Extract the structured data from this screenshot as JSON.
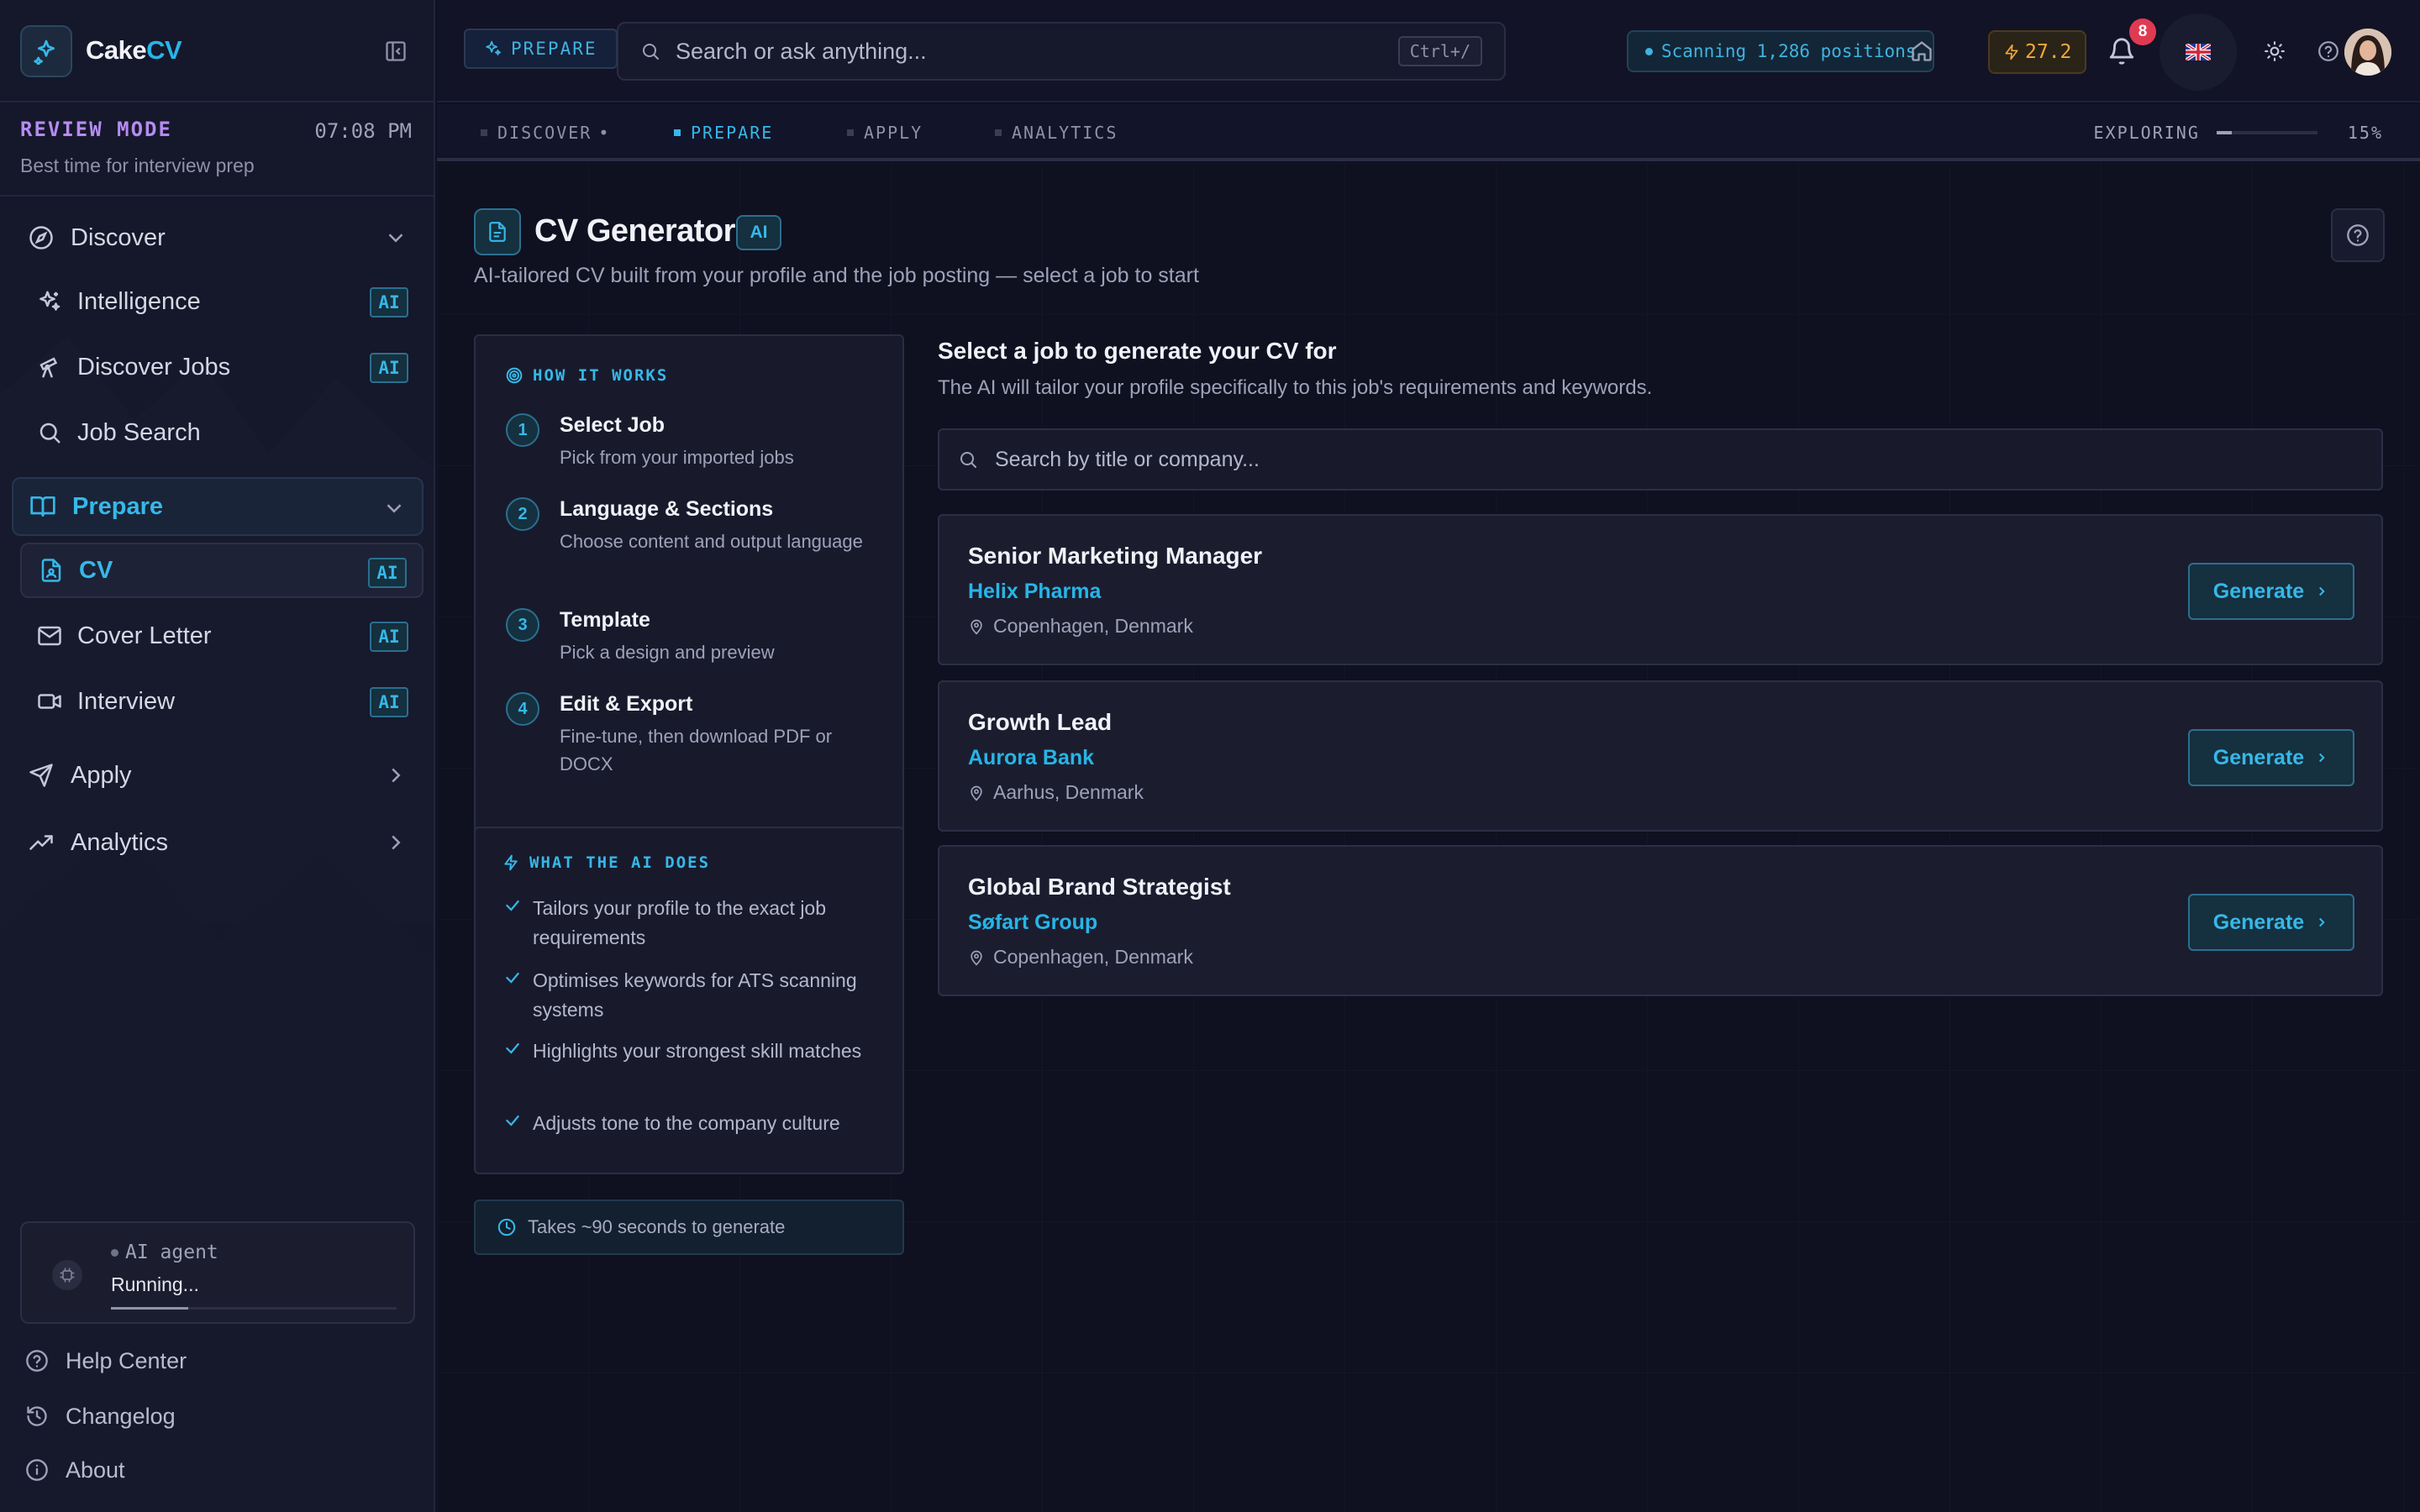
{
  "app": {
    "name_part1": "Cake",
    "name_part2": "CV"
  },
  "review": {
    "mode_label": "REVIEW MODE",
    "time": "07:08 PM",
    "subtitle": "Best time for interview prep"
  },
  "sidebar": {
    "sections": [
      {
        "label": "Discover",
        "icon": "compass-icon",
        "expanded": true
      },
      {
        "label": "Prepare",
        "icon": "book-open-icon",
        "expanded": true,
        "active": true
      },
      {
        "label": "Apply",
        "icon": "send-icon",
        "expanded": false
      },
      {
        "label": "Analytics",
        "icon": "trending-up-icon",
        "expanded": false
      }
    ],
    "discover_items": [
      {
        "label": "Intelligence",
        "icon": "sparkles-icon",
        "badge": "AI"
      },
      {
        "label": "Discover Jobs",
        "icon": "telescope-icon",
        "badge": "AI"
      },
      {
        "label": "Job Search",
        "icon": "search-icon",
        "badge": ""
      }
    ],
    "prepare_items": [
      {
        "label": "CV",
        "icon": "file-user-icon",
        "badge": "AI",
        "active": true
      },
      {
        "label": "Cover Letter",
        "icon": "mail-icon",
        "badge": "AI"
      },
      {
        "label": "Interview",
        "icon": "video-icon",
        "badge": "AI"
      }
    ],
    "agent": {
      "label": "AI agent",
      "status": "Running...",
      "progress": 0.27
    },
    "footer_links": [
      {
        "label": "Help Center",
        "icon": "help-circle-icon"
      },
      {
        "label": "Changelog",
        "icon": "history-icon"
      },
      {
        "label": "About",
        "icon": "info-icon"
      }
    ]
  },
  "topbar": {
    "crumb": "PREPARE",
    "search_placeholder": "Search or ask anything...",
    "shortcut": "Ctrl+/",
    "scanning": "Scanning 1,286 positions",
    "streak": "27.2",
    "notifications": "8"
  },
  "subtabs": {
    "items": [
      {
        "label": "DISCOVER",
        "suffix": "•",
        "active": false
      },
      {
        "label": "PREPARE",
        "suffix": "",
        "active": true
      },
      {
        "label": "APPLY",
        "suffix": "",
        "active": false
      },
      {
        "label": "ANALYTICS",
        "suffix": "",
        "active": false
      }
    ],
    "exploring_label": "EXPLORING",
    "exploring_value": "15%",
    "exploring_fraction": 0.15
  },
  "page": {
    "title": "CV Generator",
    "title_badge": "AI",
    "subtitle": "AI-tailored CV built from your profile and the job posting — select a job to start"
  },
  "how_it_works": {
    "heading": "HOW IT WORKS",
    "steps": [
      {
        "num": "1",
        "title": "Select Job",
        "desc": "Pick from your imported jobs"
      },
      {
        "num": "2",
        "title": "Language & Sections",
        "desc": "Choose content and output language"
      },
      {
        "num": "3",
        "title": "Template",
        "desc": "Pick a design and preview"
      },
      {
        "num": "4",
        "title": "Edit & Export",
        "desc": "Fine-tune, then download PDF or DOCX"
      }
    ]
  },
  "ai_does": {
    "heading": "WHAT THE AI DOES",
    "items": [
      "Tailors your profile to the exact job requirements",
      "Optimises keywords for ATS scanning systems",
      "Highlights your strongest skill matches",
      "Adjusts tone to the company culture"
    ]
  },
  "time_note": "Takes ~90 seconds to generate",
  "job_select": {
    "title": "Select a job to generate your CV for",
    "subtitle": "The AI will tailor your profile specifically to this job's requirements and keywords.",
    "search_placeholder": "Search by title or company...",
    "button_label": "Generate",
    "jobs": [
      {
        "title": "Senior Marketing Manager",
        "company": "Helix Pharma",
        "location": "Copenhagen, Denmark"
      },
      {
        "title": "Growth Lead",
        "company": "Aurora Bank",
        "location": "Aarhus, Denmark"
      },
      {
        "title": "Global Brand Strategist",
        "company": "Søfart Group",
        "location": "Copenhagen, Denmark"
      }
    ]
  },
  "colors": {
    "accent": "#27b5e6",
    "background": "#0f1020",
    "sidebar": "#15172a",
    "review_mode": "#b48cf0",
    "streak": "#f1a93a",
    "notification": "#e03a52"
  }
}
